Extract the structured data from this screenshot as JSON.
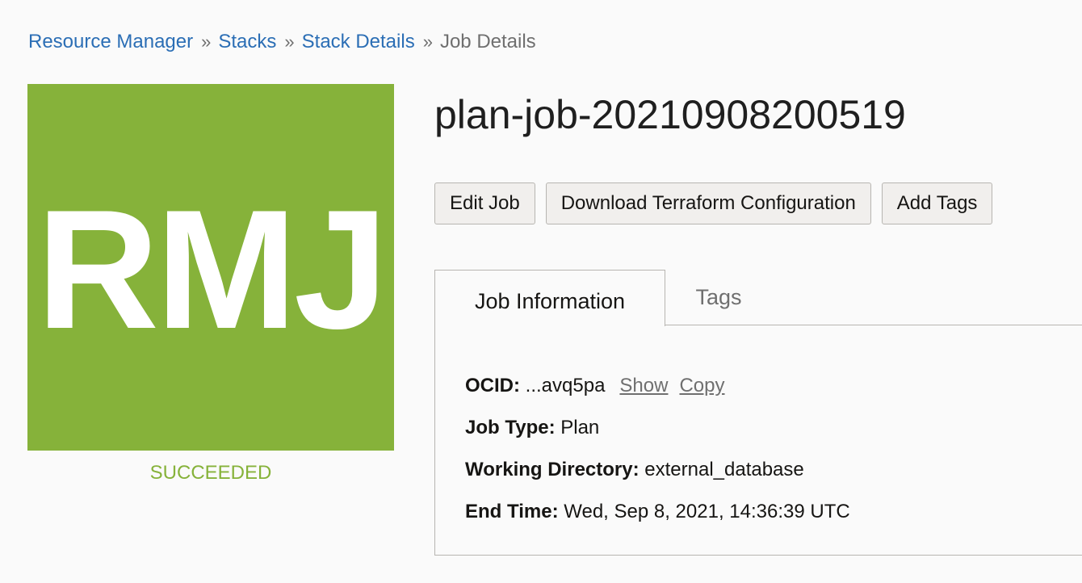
{
  "breadcrumb": {
    "items": [
      {
        "label": "Resource Manager"
      },
      {
        "label": "Stacks"
      },
      {
        "label": "Stack Details"
      }
    ],
    "separator": "»",
    "current": "Job Details"
  },
  "badge": {
    "initials": "RMJ",
    "color": "#86b23a",
    "status": "SUCCEEDED"
  },
  "title": "plan-job-20210908200519",
  "actions": {
    "edit_job": "Edit Job",
    "download_config": "Download Terraform Configuration",
    "add_tags": "Add Tags"
  },
  "tabs": [
    {
      "label": "Job Information",
      "active": true
    },
    {
      "label": "Tags",
      "active": false
    }
  ],
  "job_info": {
    "ocid_label": "OCID:",
    "ocid_value": "...avq5pa",
    "ocid_show": "Show",
    "ocid_copy": "Copy",
    "job_type_label": "Job Type:",
    "job_type_value": "Plan",
    "working_dir_label": "Working Directory:",
    "working_dir_value": "external_database",
    "end_time_label": "End Time:",
    "end_time_value": "Wed, Sep 8, 2021, 14:36:39 UTC"
  },
  "colors": {
    "link": "#2b6eb5",
    "success": "#86b23a"
  }
}
